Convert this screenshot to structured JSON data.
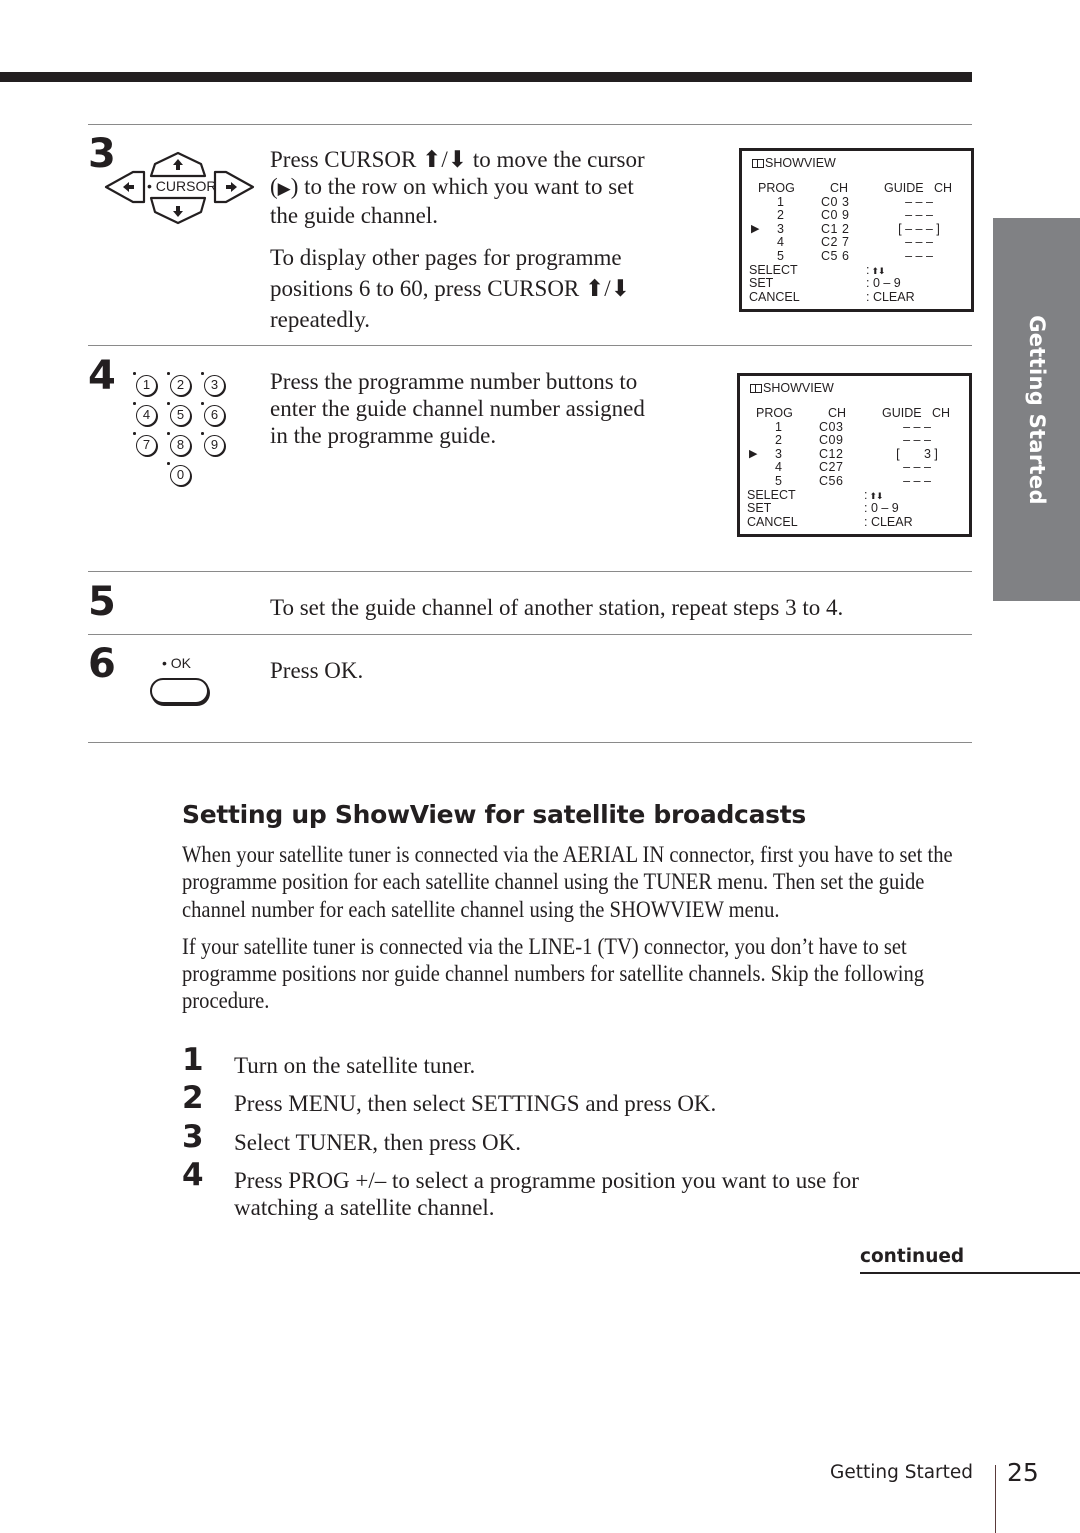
{
  "page": {
    "section_tab": "Getting Started",
    "footer_section": "Getting Started",
    "page_number": "25",
    "continued_label": "continued"
  },
  "steps_top": [
    {
      "number": "3",
      "remote_label": "• CURSOR",
      "paragraphs": [
        {
          "parts": [
            "Press CURSOR ",
            "arrow-up",
            "/",
            "arrow-down",
            "  to move the cursor (",
            "cursor-triangle",
            ") to the row on which you want to set the guide channel."
          ]
        },
        {
          "parts": [
            "To display other pages for programme positions 6 to 60, press CURSOR ",
            "arrow-up",
            "/",
            "arrow-down",
            " repeatedly."
          ]
        }
      ],
      "text_lines": {
        "l1a": "Press CURSOR ",
        "l1b": "/",
        "l1c": " to move the cursor",
        "l2a": "(",
        "l2b": ") to the row on which you want to set",
        "l3": "the guide channel.",
        "p2l1": "To display other pages for programme",
        "p2l2a": "positions 6 to 60, press CURSOR ",
        "p2l2b": "/",
        "p2l3": "repeatedly."
      }
    },
    {
      "number": "4",
      "keypad": [
        "1",
        "2",
        "3",
        "4",
        "5",
        "6",
        "7",
        "8",
        "9",
        "0"
      ],
      "text_lines": [
        "Press the programme number buttons to",
        "enter the guide channel number assigned",
        "in the programme guide."
      ]
    },
    {
      "number": "5",
      "text": "To set the guide channel of another station, repeat steps 3 to 4."
    },
    {
      "number": "6",
      "remote_label": "• OK",
      "text": "Press OK."
    }
  ],
  "osd_screens": [
    {
      "title": "SHOWVIEW",
      "headers": {
        "prog": "PROG",
        "ch": "CH",
        "guide": "GUIDE   CH"
      },
      "rows": [
        {
          "prog": "1",
          "ch": "C0 3",
          "guide": "– – –",
          "selected": false
        },
        {
          "prog": "2",
          "ch": "C0 9",
          "guide": "– – –",
          "selected": false
        },
        {
          "prog": "3",
          "ch": "C1 2",
          "guide": "[ – – – ]",
          "selected": true
        },
        {
          "prog": "4",
          "ch": "C2 7",
          "guide": "– – –",
          "selected": false
        },
        {
          "prog": "5",
          "ch": "C5 6",
          "guide": "– – –",
          "selected": false
        }
      ],
      "footer": [
        {
          "label": "SELECT",
          "value": ":"
        },
        {
          "label": "SET",
          "value": ": 0 – 9"
        },
        {
          "label": "CANCEL",
          "value": ": CLEAR"
        }
      ],
      "cursor_glyph": "▶"
    },
    {
      "title": "SHOWVIEW",
      "headers": {
        "prog": "PROG",
        "ch": "CH",
        "guide": "GUIDE   CH"
      },
      "rows": [
        {
          "prog": "1",
          "ch": "C03",
          "guide": "– – –",
          "selected": false
        },
        {
          "prog": "2",
          "ch": "C09",
          "guide": "– – –",
          "selected": false
        },
        {
          "prog": "3",
          "ch": "C12",
          "guide": "[       3 ]",
          "selected": true
        },
        {
          "prog": "4",
          "ch": "C27",
          "guide": "– – –",
          "selected": false
        },
        {
          "prog": "5",
          "ch": "C56",
          "guide": "– – –",
          "selected": false
        }
      ],
      "footer": [
        {
          "label": "SELECT",
          "value": ":"
        },
        {
          "label": "SET",
          "value": ": 0 – 9"
        },
        {
          "label": "CANCEL",
          "value": ": CLEAR"
        }
      ],
      "cursor_glyph": "▶"
    }
  ],
  "satellite_section": {
    "heading": "Setting up ShowView for satellite broadcasts",
    "paragraphs": [
      "When your satellite tuner is connected via the AERIAL IN connector, first you have to set the programme position for each satellite channel using the TUNER menu.  Then set the guide channel number for each satellite channel using the SHOWVIEW menu.",
      "If your satellite tuner is connected via the LINE-1 (TV) connector, you don’t have to set programme positions nor guide channel numbers for satellite channels.  Skip the following procedure."
    ],
    "steps": [
      {
        "number": "1",
        "lines": [
          "Turn on the satellite tuner."
        ]
      },
      {
        "number": "2",
        "lines": [
          "Press MENU, then select SETTINGS and press OK."
        ]
      },
      {
        "number": "3",
        "lines": [
          "Select TUNER, then press OK."
        ]
      },
      {
        "number": "4",
        "lines": [
          "Press PROG +/– to select a programme position you want to use for",
          "watching a satellite channel."
        ]
      }
    ]
  }
}
